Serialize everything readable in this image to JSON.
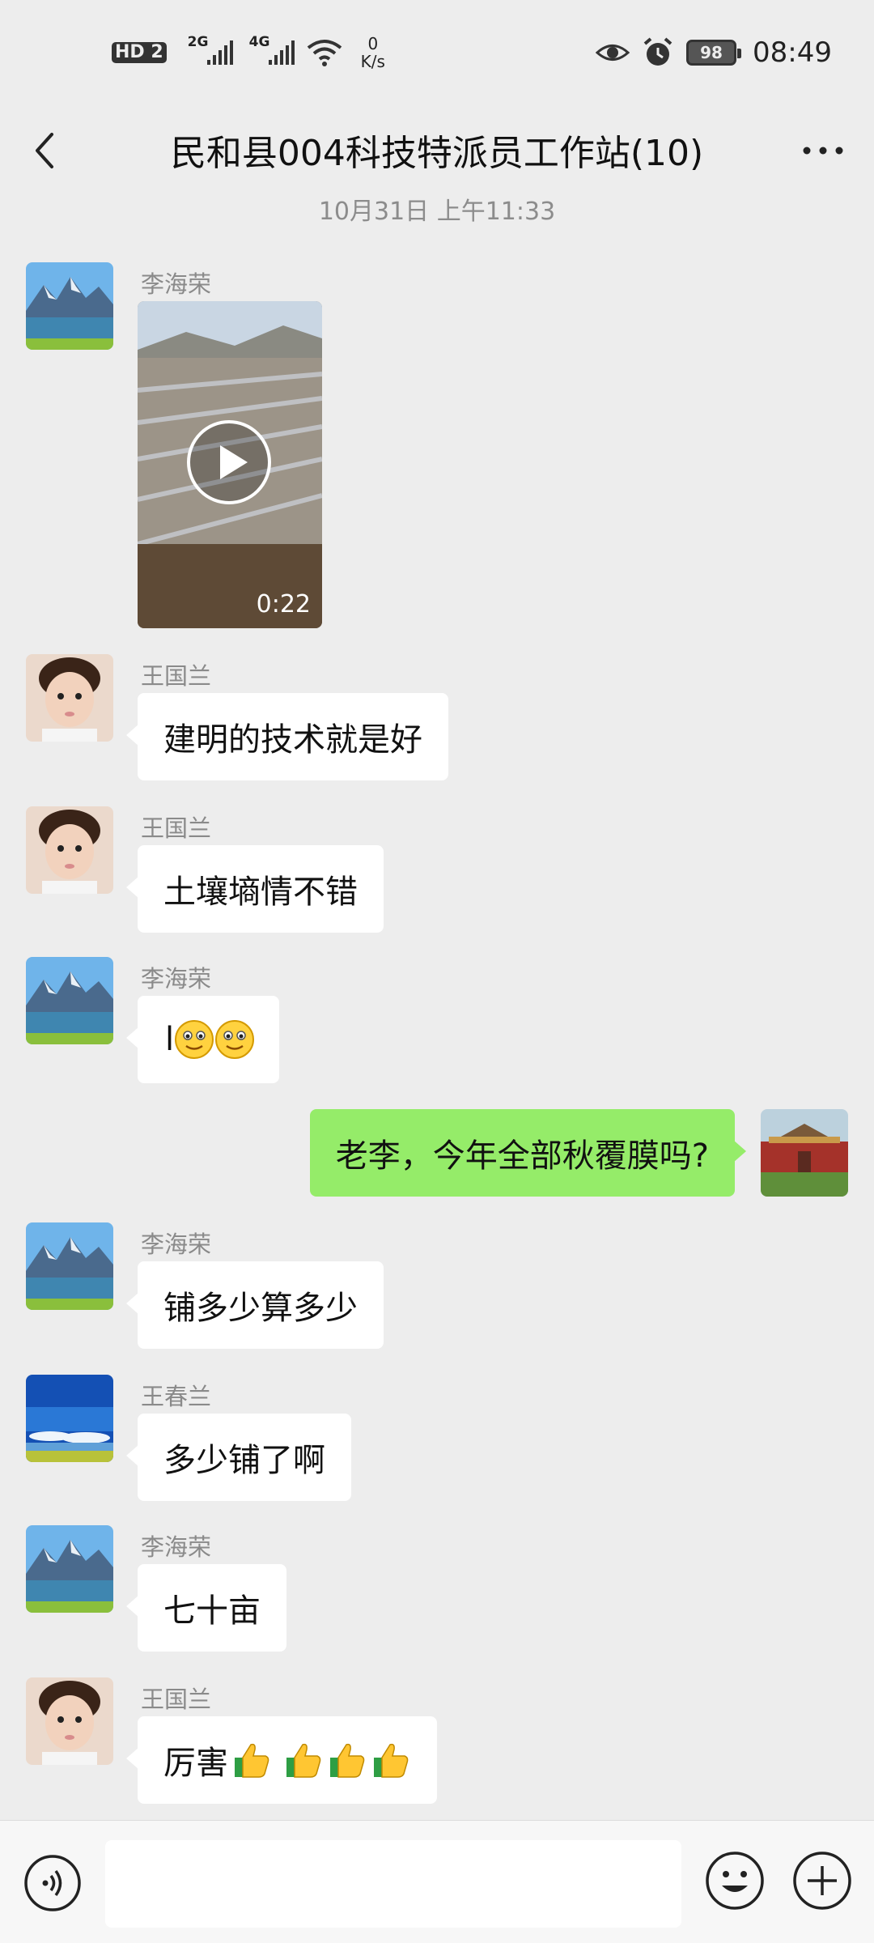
{
  "status_bar": {
    "hd_label": "HD",
    "sim_label": "2",
    "net1": "2G",
    "net2": "4G",
    "speed_value": "0",
    "speed_unit": "K/s",
    "battery": "98",
    "time": "08:49"
  },
  "header": {
    "title": "民和县004科技特派员工作站(10)"
  },
  "chat": {
    "timestamp": "10月31日 上午11:33",
    "messages": [
      {
        "sender": "李海荣",
        "type": "video",
        "duration": "0:22"
      },
      {
        "sender": "王国兰",
        "type": "text",
        "text": "建明的技术就是好"
      },
      {
        "sender": "王国兰",
        "type": "text",
        "text": "土壤墒情不错"
      },
      {
        "sender": "李海荣",
        "type": "text",
        "text": "l"
      },
      {
        "sender": "me",
        "type": "text",
        "text": "老李，今年全部秋覆膜吗?"
      },
      {
        "sender": "李海荣",
        "type": "text",
        "text": "铺多少算多少"
      },
      {
        "sender": "王春兰",
        "type": "text",
        "text": "多少铺了啊"
      },
      {
        "sender": "李海荣",
        "type": "text",
        "text": "七十亩"
      },
      {
        "sender": "王国兰",
        "type": "text",
        "text": "厉害"
      }
    ]
  },
  "icons": {
    "back": "chevron-left-icon",
    "more": "more-dots-icon",
    "voice": "voice-icon",
    "emoji": "smiley-icon",
    "plus": "plus-icon",
    "thumbs": "thumbs-up-icon",
    "smile": "smiling-face-icon"
  },
  "colors": {
    "background": "#ededed",
    "my_bubble": "#95ec69",
    "their_bubble": "#ffffff",
    "meta_text": "#8c8c8c"
  }
}
